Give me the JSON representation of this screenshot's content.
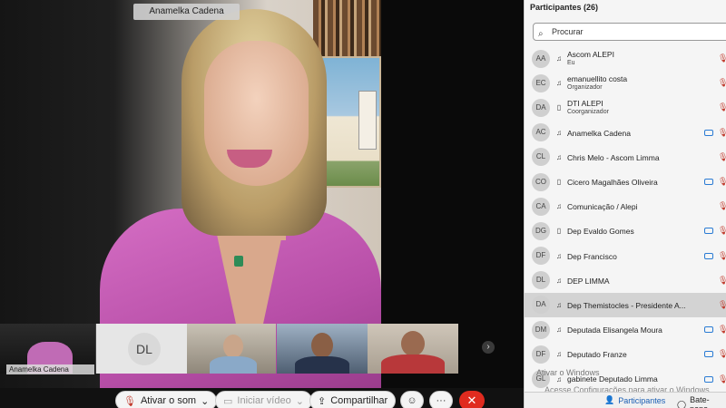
{
  "main_video": {
    "speaker_name": "Anamelka Cadena"
  },
  "self_view": {
    "name": "Anamelka Cadena"
  },
  "thumbnails": [
    {
      "initials": "DL"
    }
  ],
  "controls": {
    "mute_label": "Ativar o som",
    "video_label": "Iniciar vídeo",
    "share_label": "Compartilhar"
  },
  "panel": {
    "title": "Participantes (26)",
    "search_placeholder": "Procurar",
    "participants": [
      {
        "initials": "AA",
        "name": "Ascom ALEPI",
        "role": "Eu",
        "device": "audio",
        "camera": false
      },
      {
        "initials": "EC",
        "name": "emanuellito costa",
        "role": "Organizador",
        "device": "audio",
        "camera": false
      },
      {
        "initials": "DA",
        "name": "DTI ALEPI",
        "role": "Coorganizador",
        "device": "phone",
        "camera": false
      },
      {
        "initials": "AC",
        "name": "Anamelka Cadena",
        "role": "",
        "device": "audio",
        "camera": true
      },
      {
        "initials": "CL",
        "name": "Chris Melo - Ascom Limma",
        "role": "",
        "device": "audio",
        "camera": false
      },
      {
        "initials": "CO",
        "name": "Cicero Magalhães Oliveira",
        "role": "",
        "device": "phone",
        "camera": true
      },
      {
        "initials": "CA",
        "name": "Comunicação / Alepi",
        "role": "",
        "device": "audio",
        "camera": false
      },
      {
        "initials": "DG",
        "name": "Dep Evaldo Gomes",
        "role": "",
        "device": "phone",
        "camera": true
      },
      {
        "initials": "DF",
        "name": "Dep Francisco",
        "role": "",
        "device": "audio",
        "camera": true
      },
      {
        "initials": "DL",
        "name": "DEP LIMMA",
        "role": "",
        "device": "audio",
        "camera": false
      },
      {
        "initials": "DA",
        "name": "Dep Themistocles - Presidente A...",
        "role": "",
        "device": "audio",
        "camera": false
      },
      {
        "initials": "DM",
        "name": "Deputada Elisangela Moura",
        "role": "",
        "device": "audio",
        "camera": true
      },
      {
        "initials": "DF",
        "name": "Deputado Franze",
        "role": "",
        "device": "audio",
        "camera": true
      },
      {
        "initials": "GL",
        "name": "gabinete Deputado Limma",
        "role": "",
        "device": "audio",
        "camera": true
      }
    ],
    "highlighted_index": 10,
    "watermark_title": "Ativar o Windows",
    "watermark_text": "Acesse Configurações para ativar o Windows.",
    "footer_participants": "Participantes",
    "footer_chat": "Bate-papo"
  }
}
